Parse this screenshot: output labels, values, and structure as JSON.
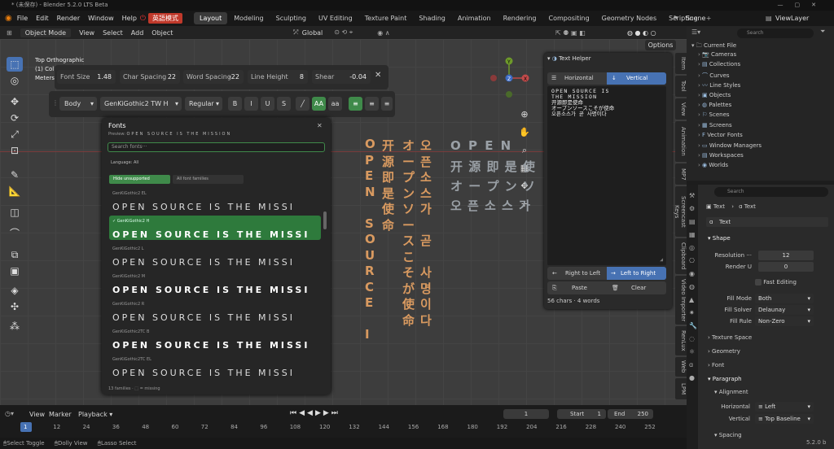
{
  "window": {
    "title": "* (未保存) - Blender 5.2.0 LTS Beta"
  },
  "menu": {
    "items": [
      "File",
      "Edit",
      "Render",
      "Window",
      "Help"
    ],
    "ime": "英語模式",
    "workspaces": [
      "Layout",
      "Modeling",
      "Sculpting",
      "UV Editing",
      "Texture Paint",
      "Shading",
      "Animation",
      "Rendering",
      "Compositing",
      "Geometry Nodes",
      "Scripting"
    ],
    "scene": "Scene",
    "view_layer": "ViewLayer"
  },
  "header3d": {
    "mode": "Object Mode",
    "view": "View",
    "select": "Select",
    "add": "Add",
    "object": "Object",
    "orientation": "Global",
    "options": "Options",
    "search_placeholder": "Search"
  },
  "viewport": {
    "info1": "Top Orthographic",
    "info2": "(1) Col",
    "info3": "Meters"
  },
  "toolbar": {
    "font_size_label": "Font Size",
    "font_size": "1.48",
    "char_spacing_label": "Char Spacing",
    "char_spacing": "22",
    "word_spacing_label": "Word Spacing",
    "word_spacing": "-22",
    "line_height_label": "Line Height",
    "line_height": "8",
    "shear_label": "Shear",
    "shear": "-0.04",
    "body": "Body",
    "font": "GenKiGothic2 TW H",
    "style": "Regular",
    "b": "B",
    "i": "I",
    "u": "U",
    "s": "S",
    "aa_upper": "AA",
    "aa_lower": "aa"
  },
  "fonts": {
    "title": "Fonts",
    "preview_label": "Preview:",
    "preview": "OPEN SOURCE IS THE MISSION",
    "search_placeholder": "Search fonts···",
    "language": "Language: All",
    "hide_unsupported": "Hide unsupported",
    "all_families": "All font families",
    "items": [
      {
        "name": "GenKiGothic2 EL",
        "sample": "OPEN SOURCE IS THE MISSI",
        "bold": false,
        "selected": false
      },
      {
        "name": "✓ GenKiGothic2 H",
        "sample": "OPEN SOURCE IS THE MISSI",
        "bold": true,
        "selected": true
      },
      {
        "name": "GenKiGothic2 L",
        "sample": "OPEN SOURCE IS THE MISSI",
        "bold": false,
        "selected": false
      },
      {
        "name": "GenKiGothic2 M",
        "sample": "OPEN SOURCE IS THE MISSI",
        "bold": true,
        "selected": false
      },
      {
        "name": "GenKiGothic2 R",
        "sample": "OPEN SOURCE IS THE MISSI",
        "bold": false,
        "selected": false
      },
      {
        "name": "GenKiGothic2TC B",
        "sample": "OPEN SOURCE IS THE MISSI",
        "bold": true,
        "selected": false
      },
      {
        "name": "GenKiGothic2TC EL",
        "sample": "OPEN SOURCE IS THE MISSI",
        "bold": false,
        "selected": false
      }
    ],
    "footer": "13 families · ⬚ = missing"
  },
  "helper": {
    "title": "Text Helper",
    "horizontal": "Horizontal",
    "vertical": "Vertical",
    "text_lines": [
      "OPEN SOURCE IS",
      "THE MISSION",
      "开源即是使命",
      "オープンソースこそが使命",
      "오픈소스가 곧 사명이다"
    ],
    "rtl": "Right to Left",
    "ltr": "Left to Right",
    "paste": "Paste",
    "clear": "Clear",
    "status": "56 chars · 4 words"
  },
  "sidetabs": [
    "Item",
    "Tool",
    "View",
    "Animation",
    "MP7",
    "Screencast Keys",
    "Clipboard",
    "Video Importer",
    "RenLux",
    "Web",
    "LPM"
  ],
  "outliner": {
    "root": "Current File",
    "items": [
      "Cameras",
      "Collections",
      "Curves",
      "Line Styles",
      "Objects",
      "Palettes",
      "Scenes",
      "Screens",
      "Vector Fonts",
      "Window Managers",
      "Workspaces",
      "Worlds"
    ]
  },
  "props": {
    "search_placeholder": "Search",
    "crumb_a": "Text",
    "crumb_b": "Text",
    "datablock": "Text",
    "shape": "Shape",
    "resolution_label": "Resolution ···",
    "resolution": "12",
    "render_u_label": "Render U",
    "render_u": "0",
    "fast_editing": "Fast Editing",
    "fill_mode_label": "Fill Mode",
    "fill_mode": "Both",
    "fill_solver_label": "Fill Solver",
    "fill_solver": "Delaunay",
    "fill_rule_label": "Fill Rule",
    "fill_rule": "Non-Zero",
    "texture_space": "Texture Space",
    "geometry": "Geometry",
    "font": "Font",
    "paragraph": "Paragraph",
    "alignment": "Alignment",
    "horizontal_label": "Horizontal",
    "horizontal": "Left",
    "vertical_label": "Vertical",
    "vertical": "Top Baseline",
    "spacing": "Spacing"
  },
  "timeline": {
    "view": "View",
    "marker": "Marker",
    "playback": "Playback",
    "current": "1",
    "start_label": "Start",
    "start": "1",
    "end_label": "End",
    "end": "250",
    "ticks": [
      "1",
      "12",
      "24",
      "36",
      "48",
      "60",
      "72",
      "84",
      "96",
      "108",
      "120",
      "132",
      "144",
      "156",
      "168",
      "180",
      "192",
      "204",
      "216",
      "228",
      "240",
      "252"
    ]
  },
  "statusbar": {
    "select": "Select Toggle",
    "dolly": "Dolly View",
    "lasso": "Lasso Select",
    "version": "5.2.0 b"
  },
  "canvas_text": {
    "col1": [
      "O",
      "P",
      "E",
      "N",
      "",
      "S",
      "O",
      "U",
      "R",
      "C",
      "E",
      "",
      "I"
    ],
    "col2": [
      "开",
      "源",
      "即",
      "是",
      "使",
      "命"
    ],
    "col3": [
      "オ",
      "ー",
      "プ",
      "ン",
      "ソ",
      "ー",
      "ス",
      "こ",
      "そ",
      "が",
      "使",
      "命"
    ],
    "col4": [
      "오",
      "픈",
      "소",
      "스",
      "가",
      "",
      "곧",
      "",
      "사",
      "명",
      "이",
      "다"
    ],
    "row1": "O P E N",
    "row2": "开 源 即 是 使",
    "row3": "オ ー プ ン ソ",
    "row4": "오 픈 소 스 가"
  },
  "colors": {
    "accent_blue": "#4772b3",
    "accent_green": "#3f8a4a",
    "text_orange": "#d99a60"
  }
}
